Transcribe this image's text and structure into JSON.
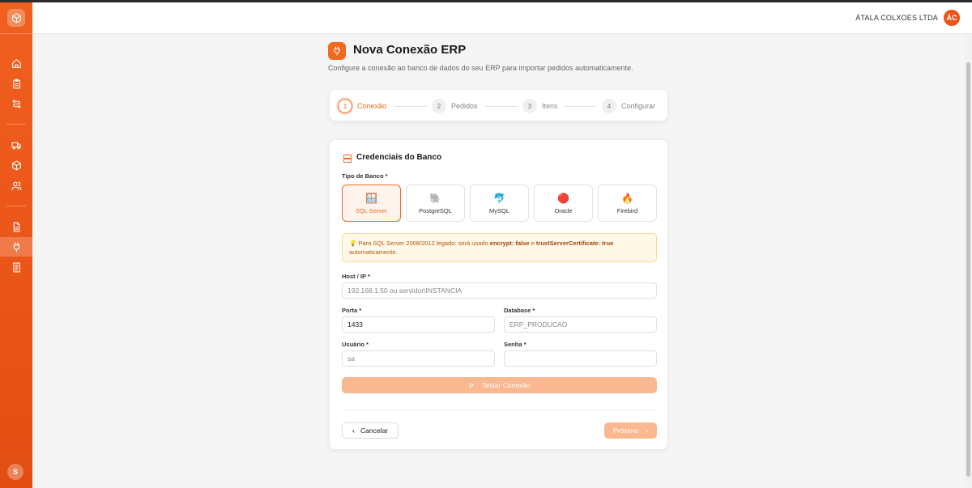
{
  "sidebar": {
    "logo_icon": "box-icon",
    "items": [
      {
        "name": "home",
        "icon": "home-icon"
      },
      {
        "name": "orders",
        "icon": "clipboard-icon"
      },
      {
        "name": "routes",
        "icon": "route-icon"
      },
      {
        "name": "delivery",
        "icon": "truck-icon"
      },
      {
        "name": "products",
        "icon": "package-icon"
      },
      {
        "name": "users",
        "icon": "users-icon"
      },
      {
        "name": "reports",
        "icon": "file-icon"
      },
      {
        "name": "erp",
        "icon": "plug-icon",
        "active": true
      },
      {
        "name": "documents",
        "icon": "receipt-icon"
      }
    ],
    "user_initial": "S"
  },
  "header": {
    "company_name": "ÁTALA COLXOES LTDA",
    "avatar_initials": "ÁC"
  },
  "page": {
    "title": "Nova Conexão ERP",
    "subtitle": "Configure a conexão ao banco de dados do seu ERP para importar pedidos automaticamente."
  },
  "stepper": [
    {
      "number": "1",
      "label": "Conexão",
      "active": true
    },
    {
      "number": "2",
      "label": "Pedidos",
      "active": false
    },
    {
      "number": "3",
      "label": "Itens",
      "active": false
    },
    {
      "number": "4",
      "label": "Configurar",
      "active": false
    }
  ],
  "card": {
    "title": "Credenciais do Banco",
    "db_type_label": "Tipo de Banco *",
    "db_options": [
      {
        "name": "SQL Server",
        "icon": "🪟",
        "selected": true
      },
      {
        "name": "PostgreSQL",
        "icon": "🐘",
        "selected": false
      },
      {
        "name": "MySQL",
        "icon": "🐬",
        "selected": false
      },
      {
        "name": "Oracle",
        "icon": "🔴",
        "selected": false
      },
      {
        "name": "Firebird",
        "icon": "🔥",
        "selected": false
      }
    ],
    "notice": {
      "icon": "💡",
      "text_before": "Para SQL Server 2008/2012 legado: será usado ",
      "code1": "encrypt: false",
      "text_middle": " e ",
      "code2": "trustServerCertificate: true",
      "text_after": " automaticamente."
    },
    "host": {
      "label": "Host / IP *",
      "value": "",
      "placeholder": "192.168.1.50 ou servidor\\INSTANCIA"
    },
    "port": {
      "label": "Porta *",
      "value": "1433"
    },
    "database": {
      "label": "Database *",
      "value": "",
      "placeholder": "ERP_PRODUCAO"
    },
    "user": {
      "label": "Usuário *",
      "value": "",
      "placeholder": "sa"
    },
    "password": {
      "label": "Senha *",
      "value": ""
    },
    "test_button": "Testar Conexão",
    "cancel_button": "Cancelar",
    "next_button": "Próximo"
  }
}
